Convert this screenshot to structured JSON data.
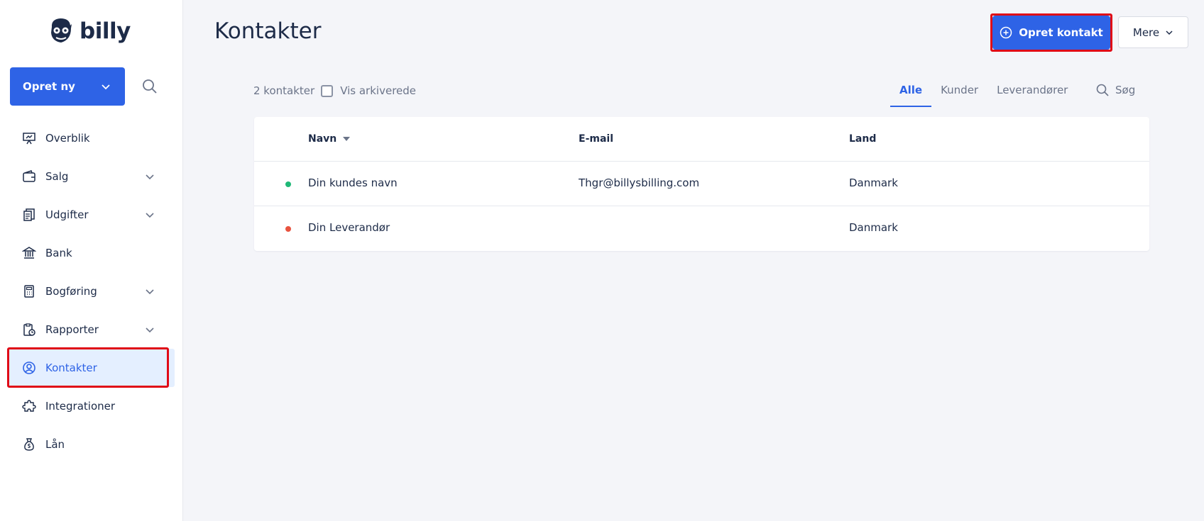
{
  "app": {
    "logo_text": "billy"
  },
  "sidebar": {
    "create_label": "Opret ny",
    "items": [
      {
        "label": "Overblik",
        "icon": "presentation-icon",
        "expandable": false
      },
      {
        "label": "Salg",
        "icon": "wallet-icon",
        "expandable": true
      },
      {
        "label": "Udgifter",
        "icon": "receipts-icon",
        "expandable": true
      },
      {
        "label": "Bank",
        "icon": "bank-icon",
        "expandable": false
      },
      {
        "label": "Bogføring",
        "icon": "calculator-icon",
        "expandable": true
      },
      {
        "label": "Rapporter",
        "icon": "report-icon",
        "expandable": true
      },
      {
        "label": "Kontakter",
        "icon": "user-circle-icon",
        "expandable": false,
        "active": true
      },
      {
        "label": "Integrationer",
        "icon": "puzzle-icon",
        "expandable": false
      },
      {
        "label": "Lån",
        "icon": "moneybag-icon",
        "expandable": false
      }
    ]
  },
  "header": {
    "title": "Kontakter",
    "primary_button": "Opret kontakt",
    "more_button": "Mere"
  },
  "toolbar": {
    "count_label": "2 kontakter",
    "archived_label": "Vis arkiverede",
    "archived_checked": false,
    "tabs": [
      {
        "label": "Alle",
        "active": true
      },
      {
        "label": "Kunder",
        "active": false
      },
      {
        "label": "Leverandører",
        "active": false
      }
    ],
    "search_label": "Søg"
  },
  "table": {
    "columns": [
      "Navn",
      "E-mail",
      "Land"
    ],
    "rows": [
      {
        "name": "Din kundes navn",
        "email": "Thgr@billysbilling.com",
        "country": "Danmark",
        "status_color": "#1fb877"
      },
      {
        "name": "Din Leverandør",
        "email": "",
        "country": "Danmark",
        "status_color": "#e8533f"
      }
    ]
  },
  "colors": {
    "accent": "#2e63e6",
    "highlight": "#e00b17",
    "text": "#1d2b48",
    "customer_dot": "#1fb877",
    "supplier_dot": "#e8533f"
  }
}
